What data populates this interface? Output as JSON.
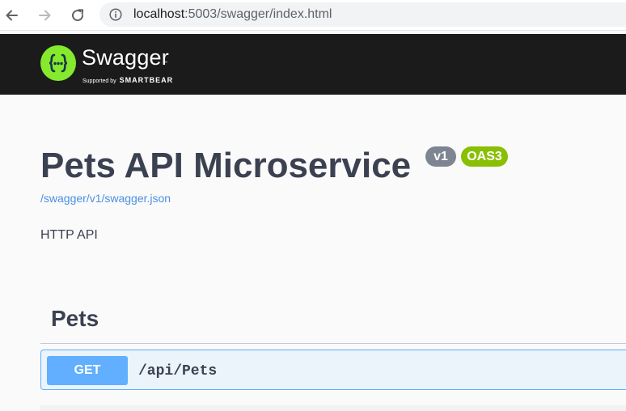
{
  "browser": {
    "url_host": "localhost",
    "url_path": ":5003/swagger/index.html"
  },
  "topbar": {
    "logo_name": "Swagger",
    "logo_tm": "™",
    "supported_by": "Supported by",
    "brand": "SMARTBEAR",
    "accent": "#85ea2d",
    "background": "#1b1b1b"
  },
  "info": {
    "title": "Pets API Microservice",
    "version_badge": "v1",
    "oas_badge": "OAS3",
    "spec_link": "/swagger/v1/swagger.json",
    "description": "HTTP API"
  },
  "tags": [
    {
      "name": "Pets",
      "operations": [
        {
          "method": "GET",
          "path": "/api/Pets",
          "color": "#61affe"
        }
      ]
    }
  ],
  "icons": {
    "back": "arrow-left-icon",
    "forward": "arrow-right-icon",
    "reload": "reload-icon",
    "info": "info-icon",
    "logo": "swagger-logo-icon"
  }
}
